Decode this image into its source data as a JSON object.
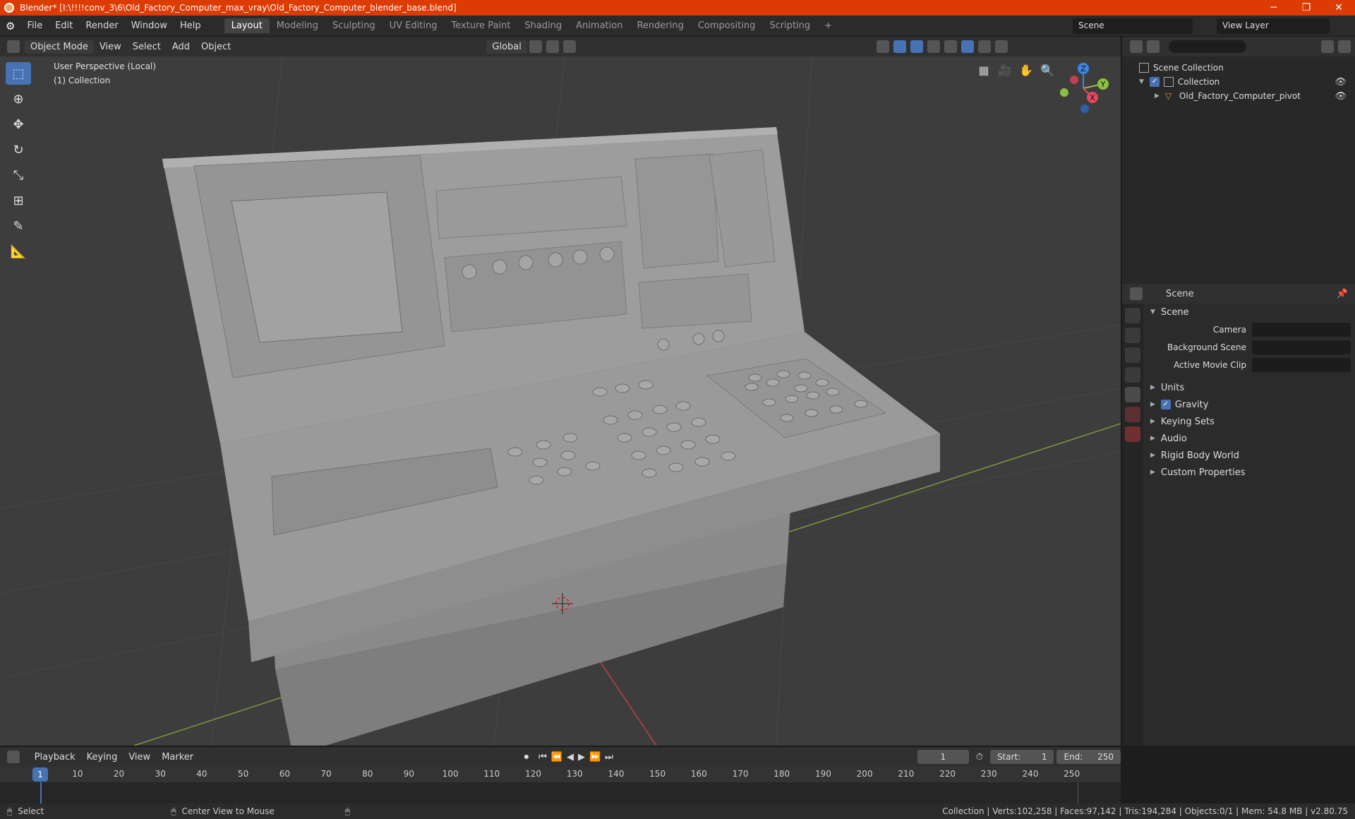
{
  "window": {
    "title": "Blender* [I:\\!!!!conv_3\\6\\Old_Factory_Computer_max_vray\\Old_Factory_Computer_blender_base.blend]",
    "minimize": "─",
    "maximize": "❐",
    "close": "✕"
  },
  "menu": [
    "File",
    "Edit",
    "Render",
    "Window",
    "Help"
  ],
  "workspaces": [
    "Layout",
    "Modeling",
    "Sculpting",
    "UV Editing",
    "Texture Paint",
    "Shading",
    "Animation",
    "Rendering",
    "Compositing",
    "Scripting"
  ],
  "add_workspace": "+",
  "scene_name": "Scene",
  "view_layer": "View Layer",
  "viewport_header": {
    "mode": "Object Mode",
    "menus": [
      "View",
      "Select",
      "Add",
      "Object"
    ],
    "orientation": "Global"
  },
  "viewport": {
    "perspective": "User Perspective (Local)",
    "collection": "(1) Collection",
    "axis_x": "X",
    "axis_y": "Y",
    "axis_z": "Z"
  },
  "outliner": {
    "root": "Scene Collection",
    "collection": "Collection",
    "object": "Old_Factory_Computer_pivot"
  },
  "properties": {
    "header": "Scene",
    "panel": "Scene",
    "camera_label": "Camera",
    "background_label": "Background Scene",
    "movieclip_label": "Active Movie Clip",
    "subpanels": [
      "Units",
      "Gravity",
      "Keying Sets",
      "Audio",
      "Rigid Body World",
      "Custom Properties"
    ]
  },
  "timeline": {
    "menus": [
      "Playback",
      "Keying",
      "View",
      "Marker"
    ],
    "current_frame": "1",
    "start_label": "Start:",
    "start": "1",
    "end_label": "End:",
    "end": "250",
    "ticks": [
      "1",
      "10",
      "20",
      "30",
      "40",
      "50",
      "60",
      "70",
      "80",
      "90",
      "100",
      "110",
      "120",
      "130",
      "140",
      "150",
      "160",
      "170",
      "180",
      "190",
      "200",
      "210",
      "220",
      "230",
      "240",
      "250"
    ]
  },
  "statusbar": {
    "left_action": "Select",
    "middle_action": "Center View to Mouse",
    "stats": "Collection | Verts:102,258 | Faces:97,142 | Tris:194,284 | Objects:0/1 | Mem: 54.8 MB | v2.80.75"
  },
  "colors": {
    "accent": "#4772b3",
    "titlebar": "#dd3b04",
    "axis_x": "#e5495d",
    "axis_y": "#8ac142",
    "axis_z": "#3d86e0"
  }
}
